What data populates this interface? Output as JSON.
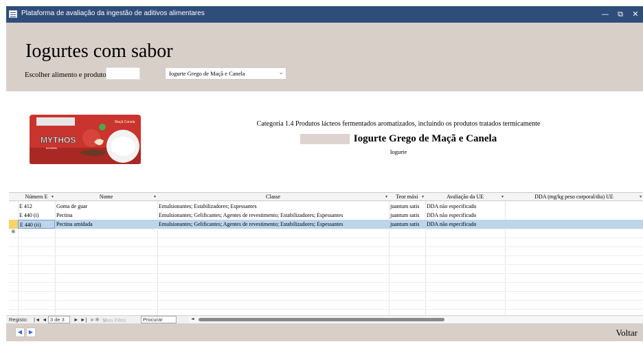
{
  "window": {
    "title": "Plataforma de avaliação da ingestão de aditivos alimentares",
    "controls": {
      "minimize": "—",
      "restore": "⧉",
      "close": "✕"
    }
  },
  "header": {
    "title": "Iogurtes com sabor",
    "filter_label": "Escolher alimento e produto",
    "filter_value": "",
    "product_select": "Iogurte Grego de Maçã e Canela"
  },
  "product": {
    "image_text": {
      "brand": "MYTHOS",
      "flavor": "Maçã Canela",
      "sub": "benefeito"
    },
    "category": "Categoria 1.4 Produtos lácteos fermentados aromatizados, incluindo os produtos tratados termicamente",
    "name": "Iogurte Grego de Maçã e Canela",
    "subcategory": "Iogurte"
  },
  "table": {
    "columns": [
      "Número E",
      "Nome",
      "Classe",
      "Teor máxi",
      "Avaliação da UE",
      "DDA (mg/kg peso corporal/dia) UE"
    ],
    "rows": [
      [
        "E 412",
        "Goma de guar",
        "Emulsionantes; Estabilizadores; Espessantes",
        "juantum satis",
        "DDA não especificado",
        ""
      ],
      [
        "E 440 (i)",
        "Pectina",
        "Emulsionantes; Gelificantes; Agentes de revestimento; Estabilizadores; Espessantes",
        "juantum satis",
        "DDA não especificado",
        ""
      ],
      [
        "E 440 (ii)",
        "Pectina amidada",
        "Emulsionantes; Gelificantes; Agentes de revestimento; Estabilizadores; Espessantes",
        "juantum satis",
        "DDA não especificado",
        ""
      ]
    ],
    "new_row_marker": "✱",
    "selected_row": 3
  },
  "navigation": {
    "label": "Registo:",
    "first": "|◄",
    "prev": "◄",
    "record": "3 de 3",
    "next": "►",
    "last": "►|",
    "new": "►✱",
    "filter": "Sem Filtro",
    "search_placeholder": "Procurar"
  },
  "footer": {
    "prev": "◀",
    "next": "▶",
    "voltar": "Voltar"
  },
  "colors": {
    "titlebar": "#2f4d7a",
    "header_band": "#d8cfc9",
    "selected_row": "#bcd5ec",
    "current_row_marker": "#f6d36b"
  }
}
